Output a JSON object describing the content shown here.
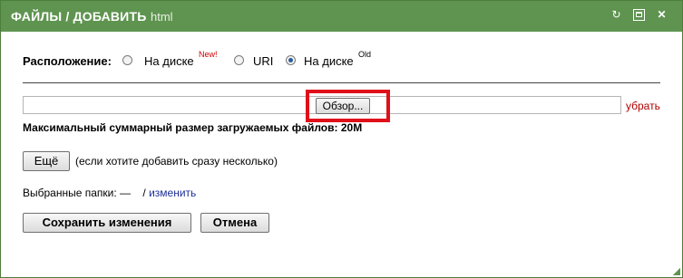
{
  "title": {
    "main": "ФАЙЛЫ / ДОБАВИТЬ",
    "sub": "html"
  },
  "titlebar_icons": [
    "refresh-icon",
    "restore-icon",
    "close-icon"
  ],
  "location": {
    "label": "Расположение:",
    "options": [
      {
        "label": "На диске",
        "badge": "New!",
        "checked": false
      },
      {
        "label": "URI",
        "badge": "",
        "checked": false
      },
      {
        "label": "На диске",
        "badge": "Old",
        "checked": true
      }
    ]
  },
  "file": {
    "browse_label": "Обзор...",
    "remove_label": "убрать",
    "max_size_text": "Максимальный суммарный размер загружаемых файлов: 20M"
  },
  "more": {
    "button_label": "Ещё",
    "note": "(если хотите добавить сразу несколько)"
  },
  "folders": {
    "label": "Выбранные папки: —",
    "separator": "/",
    "change_link": "изменить"
  },
  "actions": {
    "save_label": "Сохранить изменения",
    "cancel_label": "Отмена"
  },
  "colors": {
    "titlebar": "#5f9450",
    "highlight": "#e0101a",
    "link": "#1d2f9a",
    "remove": "#b00000"
  }
}
